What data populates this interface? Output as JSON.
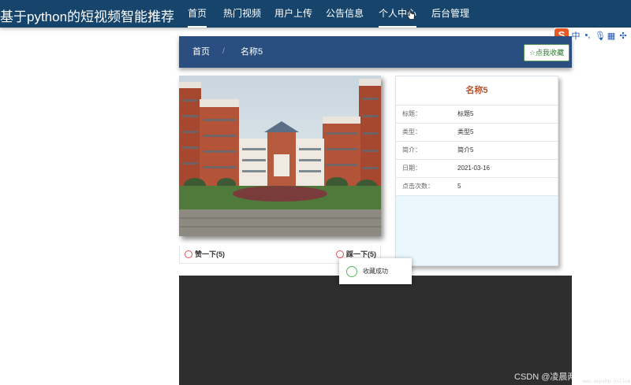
{
  "site": {
    "title": "基于python的短视频智能推荐"
  },
  "nav": {
    "items": [
      {
        "label": "首页"
      },
      {
        "label": "热门视频"
      },
      {
        "label": "用户上传"
      },
      {
        "label": "公告信息"
      },
      {
        "label": "个人中心"
      },
      {
        "label": "后台管理"
      }
    ],
    "active_index": 0
  },
  "ime_toolbar": {
    "logo": "S",
    "lang": "中"
  },
  "breadcrumb": {
    "home": "首页",
    "separator": "/",
    "current": "名称5"
  },
  "favorite_button": {
    "label": "☆点我收藏"
  },
  "votes": {
    "like_label": "赞一下(5)",
    "dislike_label": "踩一下(5)"
  },
  "detail": {
    "title": "名称5",
    "rows": [
      {
        "label": "标题：",
        "value": "标题5"
      },
      {
        "label": "类型：",
        "value": "类型5"
      },
      {
        "label": "简介：",
        "value": "简介5"
      },
      {
        "label": "日期：",
        "value": "2021-03-16"
      },
      {
        "label": "点击次数：",
        "value": "5"
      }
    ]
  },
  "toast": {
    "message": "收藏成功"
  },
  "watermark": {
    "text": "CSDN @凌晨两点半String",
    "sub": "www.aspshp.online"
  },
  "colors": {
    "nav_bg": "#17446b",
    "crumb_bg": "#2b4e80",
    "title_accent": "#b8532a",
    "success": "#5cb85c"
  }
}
